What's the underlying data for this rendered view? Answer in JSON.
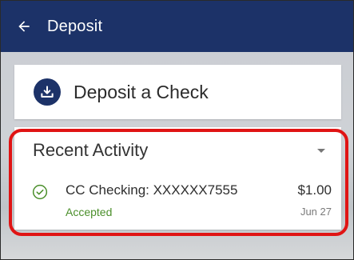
{
  "header": {
    "title": "Deposit",
    "back_icon": "arrow-left-icon"
  },
  "deposit_card": {
    "label": "Deposit a Check",
    "icon": "deposit-tray-icon"
  },
  "recent_activity": {
    "title": "Recent Activity",
    "items": [
      {
        "account": "CC Checking: XXXXXX7555",
        "status": "Accepted",
        "amount": "$1.00",
        "date": "Jun 27"
      }
    ]
  },
  "colors": {
    "app_bar": "#1c3268",
    "accepted_green": "#4b8f2b",
    "highlight_red": "#e01414"
  }
}
